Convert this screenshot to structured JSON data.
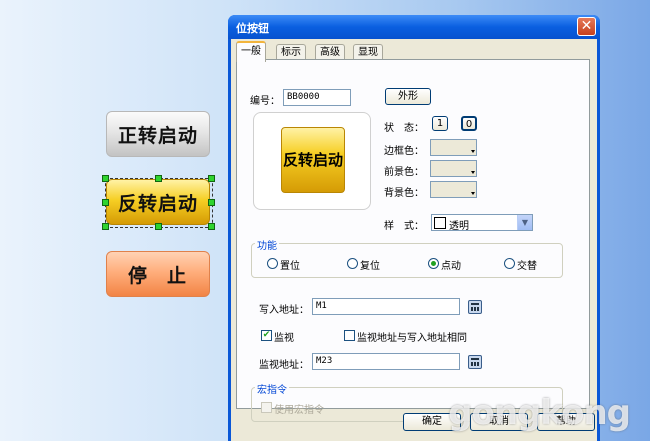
{
  "canvas": {
    "buttons": [
      {
        "label": "正转启动"
      },
      {
        "label": "反转启动"
      },
      {
        "label": "停止"
      }
    ]
  },
  "dialog": {
    "title": "位按钮",
    "close_glyph": "✕",
    "tabs": [
      "一般",
      "标示",
      "高级",
      "显现"
    ],
    "active_tab": "一般",
    "id_label": "编号：",
    "id_value": "BB0000",
    "shape_button": "外形",
    "preview_label": "反转启动",
    "state_label": "状　态：",
    "state_buttons": [
      "1",
      "0"
    ],
    "border_color_label": "边框色：",
    "fg_color_label": "前景色：",
    "bg_color_label": "背景色：",
    "style_label": "样　式：",
    "style_value": "透明",
    "function_group": {
      "title": "功能",
      "options": [
        "置位",
        "复位",
        "点动",
        "交替"
      ],
      "selected": "点动"
    },
    "write_address_label": "写入地址：",
    "write_address_value": "M1",
    "monitor_checkbox": "监视",
    "monitor_checked": true,
    "same_address_checkbox": "监视地址与写入地址相同",
    "same_address_checked": false,
    "monitor_address_label": "监视地址：",
    "monitor_address_value": "M23",
    "macro_group": {
      "title": "宏指令",
      "use_macro_label": "使用宏指令",
      "use_macro_checked": false
    },
    "footer_buttons": [
      "确定",
      "取消",
      "帮助"
    ]
  },
  "watermark": "gongkong",
  "colors": {
    "title_bar": "#0a57d7",
    "tab_accent": "#f2b43c",
    "group_title": "#0046d5",
    "radio_selected": "#21a121"
  }
}
